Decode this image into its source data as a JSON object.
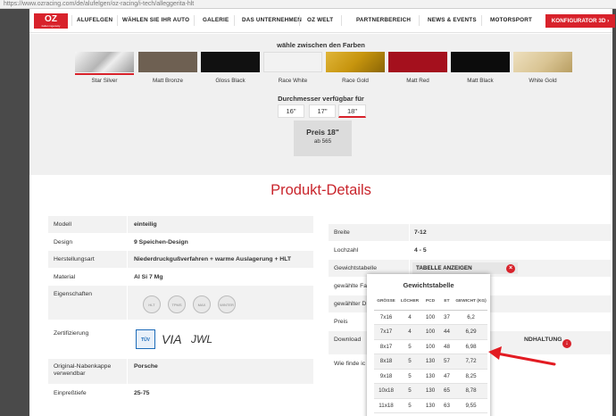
{
  "browser": {
    "url": "https://www.ozracing.com/de/alufelgen/oz-racing/i-tech/alleggerita-hlt"
  },
  "nav": {
    "logo_text": "OZ",
    "logo_sub": "italian ingenuity",
    "items": [
      "ALUFELGEN",
      "WÄHLEN SIE IHR AUTO",
      "GALERIE",
      "DAS UNTERNEHMEN",
      "OZ WELT",
      "PARTNERBEREICH",
      "NEWS & EVENTS",
      "MOTORSPORT"
    ],
    "configurator": "KONFIGURATOR 3D",
    "configurator_arrow": "›"
  },
  "colors": {
    "title": "wähle zwischen den Farben",
    "items": [
      {
        "label": "Star Silver",
        "color": "#c9c9c9",
        "selected": true
      },
      {
        "label": "Matt Bronze",
        "color": "#6e6052",
        "selected": false
      },
      {
        "label": "Gloss Black",
        "color": "#111111",
        "selected": false
      },
      {
        "label": "Race White",
        "color": "#f2f2f2",
        "selected": false
      },
      {
        "label": "Race Gold",
        "color": "#c7950e",
        "selected": false
      },
      {
        "label": "Matt Red",
        "color": "#a4101d",
        "selected": false
      },
      {
        "label": "Matt Black",
        "color": "#0c0c0c",
        "selected": false
      },
      {
        "label": "White Gold",
        "color": "#d9c493",
        "selected": false
      }
    ]
  },
  "diameter": {
    "title": "Durchmesser verfügbar für",
    "options": [
      "16\"",
      "17\"",
      "18\""
    ],
    "selected": "18\""
  },
  "price": {
    "title": "Preis 18\"",
    "sub": "ab 565"
  },
  "details": {
    "title": "Produkt-Details",
    "left": [
      {
        "k": "Modell",
        "v": "einteilig"
      },
      {
        "k": "Design",
        "v": "9 Speichen-Design"
      },
      {
        "k": "Herstellungsart",
        "v": "Niederdruckgußverfahren + warme Auslagerung + HLT"
      },
      {
        "k": "Material",
        "v": "Al Si 7 Mg"
      },
      {
        "k": "Eigenschaften",
        "v": ""
      },
      {
        "k": "Zertifizierung",
        "v": ""
      },
      {
        "k": "Original-Nabenkappe verwendbar",
        "v": "Porsche"
      },
      {
        "k": "Einpreßtiefe",
        "v": "25-75"
      }
    ],
    "cert_marks": [
      "TÜV",
      "VIA",
      "JWL"
    ],
    "props_icons": [
      "HLT",
      "TPMS READY",
      "MAX",
      "WINTER PROOF"
    ],
    "right": [
      {
        "k": "Breite",
        "v": "7-12"
      },
      {
        "k": "Lochzahl",
        "v": "4 - 5"
      },
      {
        "k": "Gewichtstabelle",
        "v": ""
      },
      {
        "k": "gewählte Fa",
        "v": ""
      },
      {
        "k": "gewählter D",
        "v": ""
      },
      {
        "k": "Preis",
        "v": ""
      },
      {
        "k": "Download",
        "v": ""
      },
      {
        "k": "Wie finde ic",
        "v": ""
      }
    ],
    "gewicht_button": "TABELLE ANZEIGEN",
    "close_glyph": "×",
    "download_text": "NDHALTUNG",
    "download_glyph": "↓"
  },
  "weight_table": {
    "title": "Gewichtstabelle",
    "headers": [
      "GRÖSSE",
      "LÖCHER",
      "PCD",
      "ET",
      "GEWICHT (KG)"
    ],
    "rows": [
      [
        "7x16",
        "4",
        "100",
        "37",
        "6,2"
      ],
      [
        "7x17",
        "4",
        "100",
        "44",
        "6,29"
      ],
      [
        "8x17",
        "5",
        "100",
        "48",
        "6,98"
      ],
      [
        "8x18",
        "5",
        "130",
        "57",
        "7,72"
      ],
      [
        "9x18",
        "5",
        "130",
        "47",
        "8,25"
      ],
      [
        "10x18",
        "5",
        "130",
        "65",
        "8,78"
      ],
      [
        "11x18",
        "5",
        "130",
        "63",
        "9,55"
      ]
    ]
  },
  "annotation": {
    "color": "#e21b22"
  }
}
